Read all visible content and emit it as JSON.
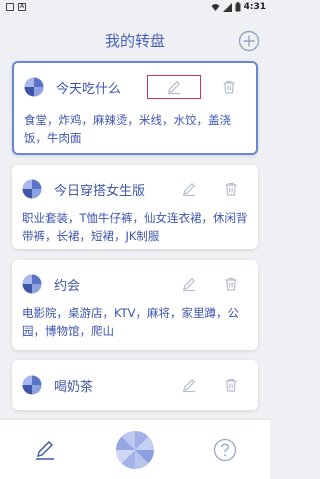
{
  "status": {
    "time": "4:31"
  },
  "header": {
    "title": "我的转盘"
  },
  "wheels": [
    {
      "title": "今天吃什么",
      "items": "食堂，炸鸡，麻辣烫，米线，水饺，盖浇饭，牛肉面"
    },
    {
      "title": "今日穿搭女生版",
      "items": "职业套装，T恤牛仔裤，仙女连衣裙，休闲背带裤，长裙，短裙，JK制服"
    },
    {
      "title": "约会",
      "items": "电影院，桌游店，KTV，麻将，家里蹲，公园，博物馆，爬山"
    },
    {
      "title": "喝奶茶",
      "items": ""
    }
  ],
  "colors": {
    "accent": "#4a62b8",
    "highlight": "#d4344b",
    "background": "#eef0f4"
  }
}
